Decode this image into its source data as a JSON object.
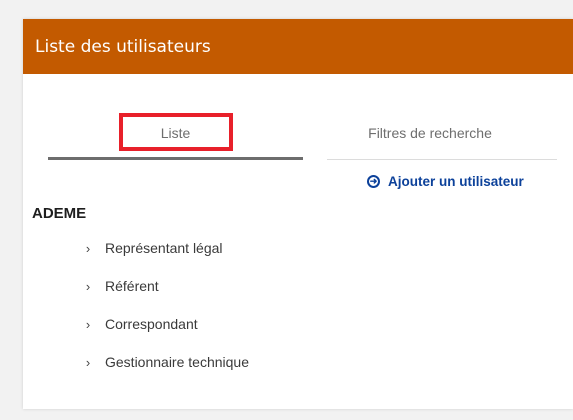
{
  "panel": {
    "title": "Liste des utilisateurs"
  },
  "tabs": [
    {
      "label": "Liste",
      "active": true
    },
    {
      "label": "Filtres de recherche",
      "active": false
    }
  ],
  "actions": {
    "add_user_label": "Ajouter un utilisateur",
    "add_user_icon": "arrow-circle-right-icon"
  },
  "group": {
    "title": "ADEME",
    "items": [
      {
        "label": "Représentant légal"
      },
      {
        "label": "Référent"
      },
      {
        "label": "Correspondant"
      },
      {
        "label": "Gestionnaire technique"
      }
    ]
  },
  "colors": {
    "header": "#c35a00",
    "accent": "#0c419a",
    "highlight": "#e8202a"
  }
}
